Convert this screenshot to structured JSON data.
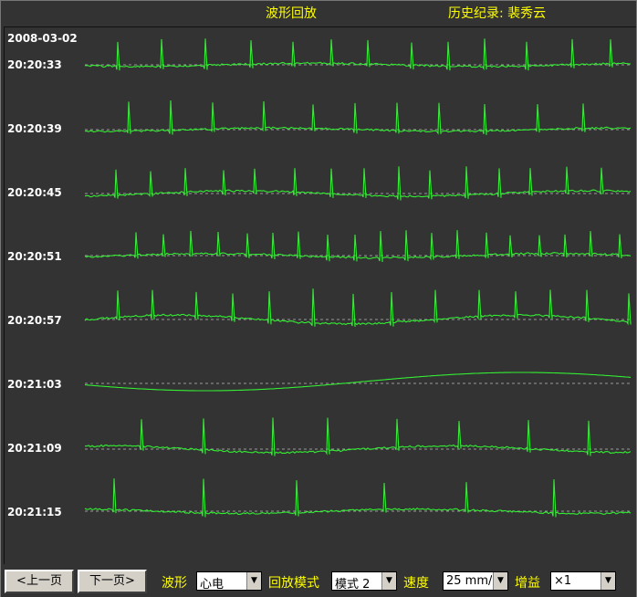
{
  "header": {
    "title": "波形回放",
    "record": "历史纪录: 裴秀云"
  },
  "display": {
    "date": "2008-03-02",
    "rows": [
      {
        "time": "20:20:33"
      },
      {
        "time": "20:20:39"
      },
      {
        "time": "20:20:45"
      },
      {
        "time": "20:20:51"
      },
      {
        "time": "20:20:57"
      },
      {
        "time": "20:21:03"
      },
      {
        "time": "20:21:09"
      },
      {
        "time": "20:21:15"
      }
    ]
  },
  "controls": {
    "prev_label": "<上一页",
    "next_label": "下一页>",
    "waveform_label": "波形",
    "waveform_value": "心电",
    "mode_label": "回放模式",
    "mode_value": "模式 2",
    "speed_label": "速度",
    "speed_value": "25 mm/",
    "gain_label": "增益",
    "gain_value": "×1"
  },
  "colors": {
    "trace": "#33ee33",
    "baseline": "#bbbbbb",
    "label": "#ffff00",
    "background": "#333333"
  },
  "icons": {
    "dropdown": "chevron-down-icon"
  }
}
